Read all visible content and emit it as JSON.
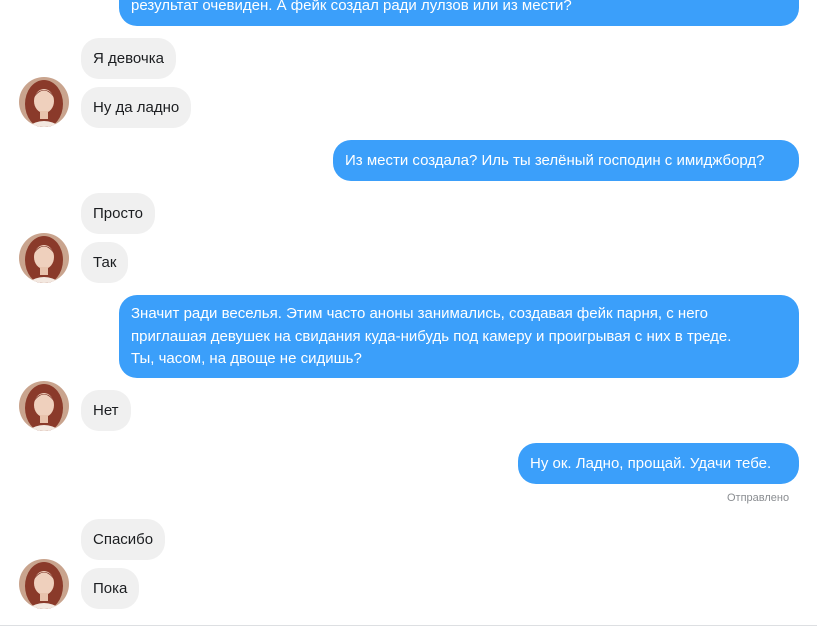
{
  "conversation": {
    "messages": [
      {
        "direction": "out",
        "text": "результат очевиден. А фейк создал ради лулзов или из мести?"
      },
      {
        "direction": "in",
        "text": "Я девочка"
      },
      {
        "direction": "in",
        "text": "Ну да ладно"
      },
      {
        "direction": "out",
        "text": "Из мести создала? Иль ты зелёный господин с имиджборд?"
      },
      {
        "direction": "in",
        "text": "Просто"
      },
      {
        "direction": "in",
        "text": "Так"
      },
      {
        "direction": "out",
        "lines": [
          "Значит ради веселья. Этим часто аноны занимались, создавая фейк парня, с него",
          "приглашая девушек на свидания куда-нибудь под камеру и проигрывая с них в треде.",
          "Ты, часом, на двоще не сидишь?"
        ]
      },
      {
        "direction": "in",
        "text": "Нет"
      },
      {
        "direction": "out",
        "text": "Ну ок. Ладно, прощай. Удачи тебе."
      },
      {
        "direction": "in",
        "text": "Спасибо"
      },
      {
        "direction": "in",
        "text": "Пока"
      }
    ],
    "status_sent": "Отправлено"
  },
  "theme": {
    "outgoing_bubble": "#3b9ffa",
    "incoming_bubble": "#f0f0f0",
    "avatar_hair": "#8a3a2a"
  },
  "icons": {
    "avatar": "contact-avatar-icon"
  }
}
